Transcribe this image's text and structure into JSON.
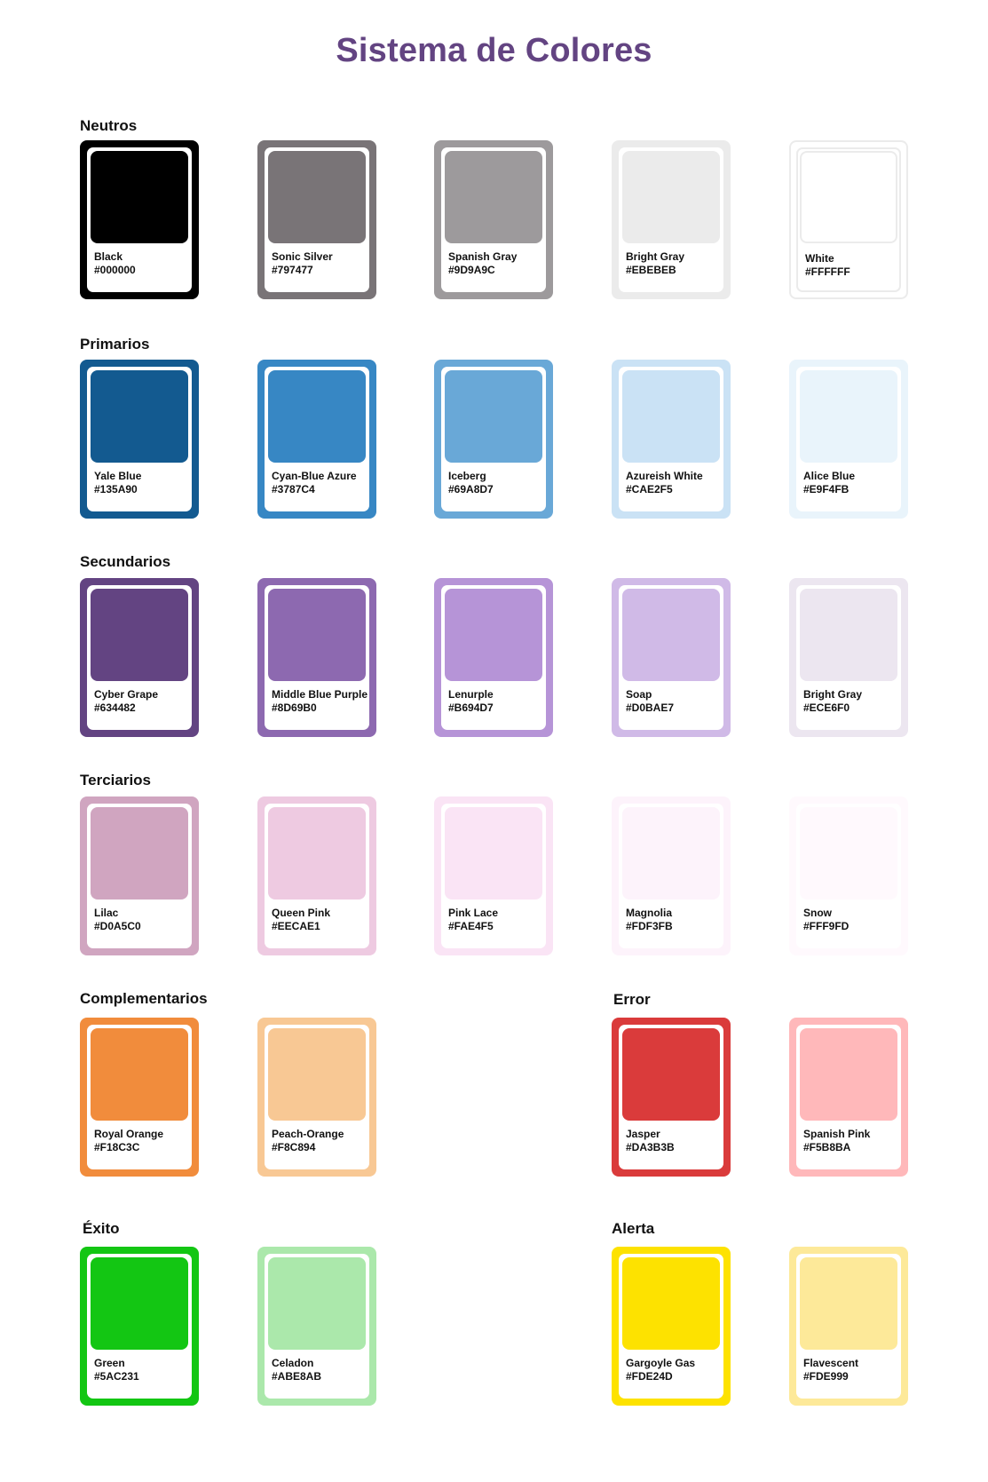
{
  "title": "Sistema de Colores",
  "sections": {
    "neutros": "Neutros",
    "primarios": "Primarios",
    "secundarios": "Secundarios",
    "terciarios": "Terciarios",
    "complementarios": "Complementarios",
    "error": "Error",
    "exito": "Éxito",
    "alerta": "Alerta"
  },
  "colors": {
    "neutros": [
      {
        "name": "Black",
        "hex": "#000000"
      },
      {
        "name": "Sonic Silver",
        "hex": "#797477"
      },
      {
        "name": "Spanish Gray",
        "hex": "#9D9A9C"
      },
      {
        "name": "Bright Gray",
        "hex": "#EBEBEB"
      },
      {
        "name": "White",
        "hex": "#FFFFFF"
      }
    ],
    "primarios": [
      {
        "name": "Yale Blue",
        "hex": "#135A90"
      },
      {
        "name": "Cyan-Blue Azure",
        "hex": "#3787C4"
      },
      {
        "name": "Iceberg",
        "hex": "#69A8D7"
      },
      {
        "name": "Azureish White",
        "hex": "#CAE2F5"
      },
      {
        "name": "Alice Blue",
        "hex": "#E9F4FB"
      }
    ],
    "secundarios": [
      {
        "name": "Cyber Grape",
        "hex": "#634482"
      },
      {
        "name": "Middle Blue Purple",
        "hex": "#8D69B0"
      },
      {
        "name": "Lenurple",
        "hex": "#B694D7"
      },
      {
        "name": "Soap",
        "hex": "#D0BAE7"
      },
      {
        "name": "Bright Gray",
        "hex": "#ECE6F0"
      }
    ],
    "terciarios": [
      {
        "name": "Lilac",
        "hex": "#D0A5C0"
      },
      {
        "name": "Queen Pink",
        "hex": "#EECAE1"
      },
      {
        "name": "Pink Lace",
        "hex": "#FAE4F5"
      },
      {
        "name": "Magnolia",
        "hex": "#FDF3FB"
      },
      {
        "name": "Snow",
        "hex": "#FFF9FD"
      }
    ],
    "complementarios": [
      {
        "name": "Royal Orange",
        "hex": "#F18C3C"
      },
      {
        "name": "Peach-Orange",
        "hex": "#F8C894"
      }
    ],
    "error": [
      {
        "name": "Jasper",
        "hex": "#DA3B3B"
      },
      {
        "name": "Spanish Pink",
        "hex": "#F5B8BA"
      }
    ],
    "exito": [
      {
        "name": "Green",
        "hex": "#5AC231"
      },
      {
        "name": "Celadon",
        "hex": "#ABE8AB"
      }
    ],
    "alerta": [
      {
        "name": "Gargoyle Gas",
        "hex": "#FDE24D"
      },
      {
        "name": "Flavescent",
        "hex": "#FDE999"
      }
    ]
  },
  "render_colors": {
    "neutros": [
      "#000000",
      "#797477",
      "#9D9A9C",
      "#EBEBEB",
      "#FFFFFF"
    ],
    "primarios": [
      "#135A90",
      "#3787C4",
      "#69A8D7",
      "#CAE2F5",
      "#E9F4FB"
    ],
    "secundarios": [
      "#634482",
      "#8D69B0",
      "#B694D7",
      "#D0BAE7",
      "#ECE6F0"
    ],
    "terciarios": [
      "#D0A5C0",
      "#EECAE1",
      "#FAE4F5",
      "#FDF3FB",
      "#FFF9FD"
    ],
    "complementarios": [
      "#F18C3C",
      "#F8C894"
    ],
    "error": [
      "#DA3B3B",
      "#FFB8BA"
    ],
    "exito": [
      "#13C613",
      "#ABE8AB"
    ],
    "alerta": [
      "#FDE200",
      "#FDE999"
    ]
  }
}
